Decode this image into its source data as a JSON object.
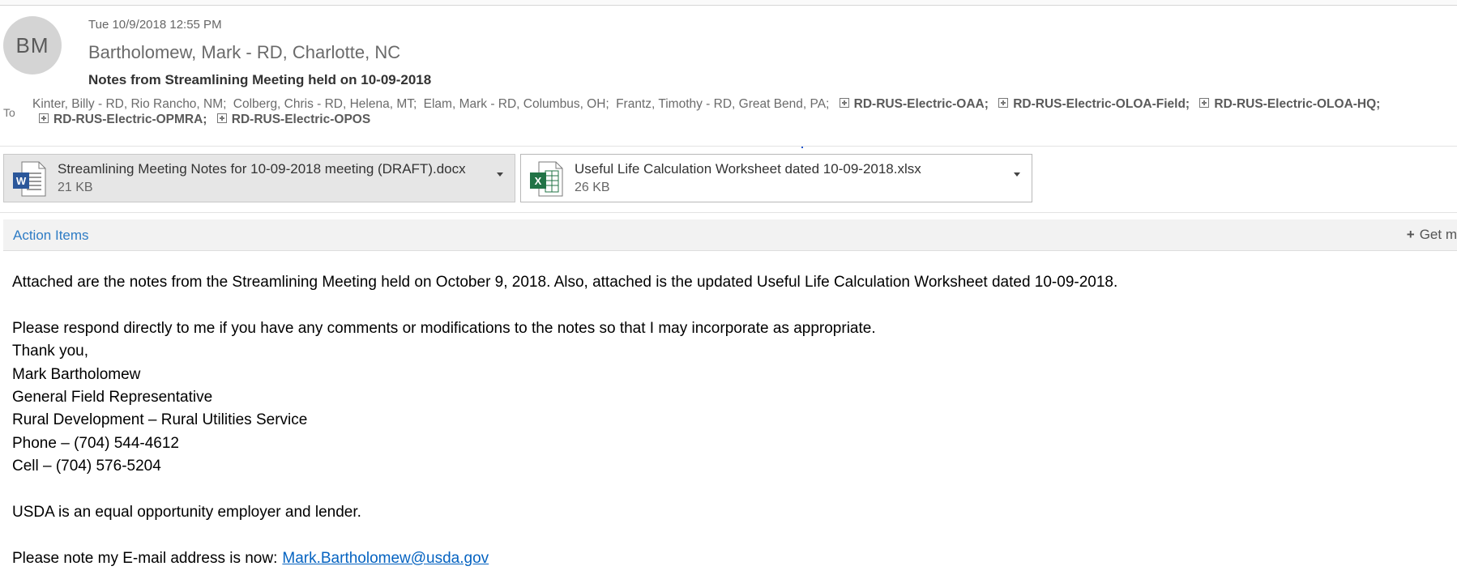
{
  "header": {
    "avatar_initials": "BM",
    "sent": "Tue 10/9/2018 12:55 PM",
    "sender": "Bartholomew, Mark - RD, Charlotte, NC",
    "subject": "Notes from Streamlining Meeting held on 10-09-2018",
    "to_label": "To",
    "recipients": [
      "Kinter, Billy - RD, Rio Rancho, NM;",
      "Colberg, Chris - RD, Helena, MT;",
      "Elam, Mark - RD, Columbus, OH;",
      "Frantz, Timothy - RD, Great Bend, PA;"
    ],
    "groups": [
      "RD-RUS-Electric-OAA;",
      "RD-RUS-Electric-OLOA-Field;",
      "RD-RUS-Electric-OLOA-HQ;",
      "RD-RUS-Electric-OPMRA;",
      "RD-RUS-Electric-OPOS"
    ]
  },
  "attachments": [
    {
      "name": "Streamlining Meeting Notes for 10-09-2018 meeting (DRAFT).docx",
      "size": "21 KB",
      "icon": "word-doc-icon",
      "color": "#2b579a"
    },
    {
      "name": "Useful Life Calculation Worksheet dated 10-09-2018.xlsx",
      "size": "26 KB",
      "icon": "excel-doc-icon",
      "color": "#217346"
    }
  ],
  "action_bar": {
    "label": "Action Items",
    "get_more": "Get m"
  },
  "body": {
    "line1": "Attached are the notes from the Streamlining Meeting held on October 9, 2018.  Also, attached is the updated Useful Life Calculation Worksheet dated 10-09-2018.",
    "line2": "Please respond directly to me if you have any comments or modifications to the notes so that I may incorporate as appropriate.",
    "thanks": "Thank you,",
    "sig_name": "Mark Bartholomew",
    "sig_title": "General Field Representative",
    "sig_org": "Rural Development – Rural Utilities Service",
    "sig_phone": "Phone – (704) 544-4612",
    "sig_cell": "Cell – (704) 576-5204",
    "equal_opp": "USDA is an equal opportunity employer and lender.",
    "email_note": "Please note my E-mail address is now:",
    "email_link": "Mark.Bartholomew@usda.gov"
  },
  "colors": {
    "accent": "#2e7cc5",
    "link": "#0563c1"
  }
}
